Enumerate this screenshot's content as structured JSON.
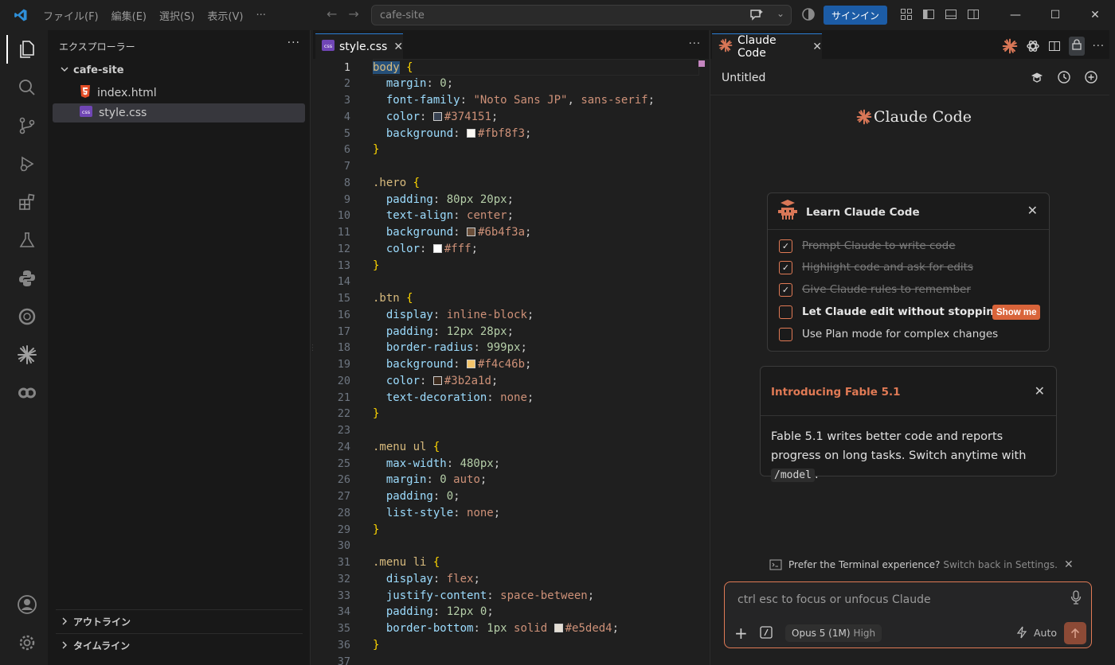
{
  "titlebar": {
    "menu": [
      "ファイル(F)",
      "編集(E)",
      "選択(S)",
      "表示(V)",
      "···"
    ],
    "search_text": "cafe-site",
    "signin_label": "サインイン"
  },
  "sidebar": {
    "header": "エクスプローラー",
    "more": "···",
    "folder": "cafe-site",
    "files": [
      {
        "name": "index.html",
        "type": "html"
      },
      {
        "name": "style.css",
        "type": "css"
      }
    ],
    "sections": [
      "アウトライン",
      "タイムライン"
    ]
  },
  "editor": {
    "tab_label": "style.css",
    "file_badge": "css",
    "more": "···",
    "line_numbers": [
      "1",
      "2",
      "3",
      "4",
      "5",
      "6",
      "7",
      "8",
      "9",
      "10",
      "11",
      "12",
      "13",
      "14",
      "15",
      "16",
      "17",
      "18",
      "19",
      "20",
      "21",
      "22",
      "23",
      "24",
      "25",
      "26",
      "27",
      "28",
      "29",
      "30",
      "31",
      "32",
      "33",
      "34",
      "35",
      "36",
      "37"
    ],
    "lines": [
      [
        [
          "sel",
          "body"
        ],
        [
          "",
          ""
        ],
        [
          "brace",
          " {"
        ]
      ],
      [
        [
          "",
          "  "
        ],
        [
          "prop",
          "margin"
        ],
        [
          "",
          ": "
        ],
        [
          "num",
          "0"
        ],
        [
          "",
          ";"
        ]
      ],
      [
        [
          "",
          "  "
        ],
        [
          "prop",
          "font-family"
        ],
        [
          "",
          ": "
        ],
        [
          "str",
          "\"Noto Sans JP\""
        ],
        [
          "",
          ", "
        ],
        [
          "val",
          "sans-serif"
        ],
        [
          "",
          ";"
        ]
      ],
      [
        [
          "",
          "  "
        ],
        [
          "prop",
          "color"
        ],
        [
          "",
          ": "
        ],
        [
          "sw",
          "#374151"
        ],
        [
          "val",
          "#374151"
        ],
        [
          "",
          ";"
        ]
      ],
      [
        [
          "",
          "  "
        ],
        [
          "prop",
          "background"
        ],
        [
          "",
          ": "
        ],
        [
          "sw",
          "#fbf8f3"
        ],
        [
          "val",
          "#fbf8f3"
        ],
        [
          "",
          ";"
        ]
      ],
      [
        [
          "brace",
          "}"
        ]
      ],
      [],
      [
        [
          "sel",
          ".hero"
        ],
        [
          "brace",
          " {"
        ]
      ],
      [
        [
          "",
          "  "
        ],
        [
          "prop",
          "padding"
        ],
        [
          "",
          ": "
        ],
        [
          "num",
          "80px 20px"
        ],
        [
          "",
          ";"
        ]
      ],
      [
        [
          "",
          "  "
        ],
        [
          "prop",
          "text-align"
        ],
        [
          "",
          ": "
        ],
        [
          "val",
          "center"
        ],
        [
          "",
          ";"
        ]
      ],
      [
        [
          "",
          "  "
        ],
        [
          "prop",
          "background"
        ],
        [
          "",
          ": "
        ],
        [
          "sw",
          "#6b4f3a"
        ],
        [
          "val",
          "#6b4f3a"
        ],
        [
          "",
          ";"
        ]
      ],
      [
        [
          "",
          "  "
        ],
        [
          "prop",
          "color"
        ],
        [
          "",
          ": "
        ],
        [
          "sw",
          "#fff"
        ],
        [
          "val",
          "#fff"
        ],
        [
          "",
          ";"
        ]
      ],
      [
        [
          "brace",
          "}"
        ]
      ],
      [],
      [
        [
          "sel",
          ".btn"
        ],
        [
          "brace",
          " {"
        ]
      ],
      [
        [
          "",
          "  "
        ],
        [
          "prop",
          "display"
        ],
        [
          "",
          ": "
        ],
        [
          "val",
          "inline-block"
        ],
        [
          "",
          ";"
        ]
      ],
      [
        [
          "",
          "  "
        ],
        [
          "prop",
          "padding"
        ],
        [
          "",
          ": "
        ],
        [
          "num",
          "12px 28px"
        ],
        [
          "",
          ";"
        ]
      ],
      [
        [
          "",
          "  "
        ],
        [
          "prop",
          "border-radius"
        ],
        [
          "",
          ": "
        ],
        [
          "num",
          "999px"
        ],
        [
          "",
          ";"
        ]
      ],
      [
        [
          "",
          "  "
        ],
        [
          "prop",
          "background"
        ],
        [
          "",
          ": "
        ],
        [
          "sw",
          "#f4c46b"
        ],
        [
          "val",
          "#f4c46b"
        ],
        [
          "",
          ";"
        ]
      ],
      [
        [
          "",
          "  "
        ],
        [
          "prop",
          "color"
        ],
        [
          "",
          ": "
        ],
        [
          "sw",
          "#3b2a1d"
        ],
        [
          "val",
          "#3b2a1d"
        ],
        [
          "",
          ";"
        ]
      ],
      [
        [
          "",
          "  "
        ],
        [
          "prop",
          "text-decoration"
        ],
        [
          "",
          ": "
        ],
        [
          "val",
          "none"
        ],
        [
          "",
          ";"
        ]
      ],
      [
        [
          "brace",
          "}"
        ]
      ],
      [],
      [
        [
          "sel",
          ".menu ul"
        ],
        [
          "brace",
          " {"
        ]
      ],
      [
        [
          "",
          "  "
        ],
        [
          "prop",
          "max-width"
        ],
        [
          "",
          ": "
        ],
        [
          "num",
          "480px"
        ],
        [
          "",
          ";"
        ]
      ],
      [
        [
          "",
          "  "
        ],
        [
          "prop",
          "margin"
        ],
        [
          "",
          ": "
        ],
        [
          "num",
          "0"
        ],
        [
          "",
          ""
        ],
        [
          "val",
          " auto"
        ],
        [
          "",
          ";"
        ]
      ],
      [
        [
          "",
          "  "
        ],
        [
          "prop",
          "padding"
        ],
        [
          "",
          ": "
        ],
        [
          "num",
          "0"
        ],
        [
          "",
          ";"
        ]
      ],
      [
        [
          "",
          "  "
        ],
        [
          "prop",
          "list-style"
        ],
        [
          "",
          ": "
        ],
        [
          "val",
          "none"
        ],
        [
          "",
          ";"
        ]
      ],
      [
        [
          "brace",
          "}"
        ]
      ],
      [],
      [
        [
          "sel",
          ".menu li"
        ],
        [
          "brace",
          " {"
        ]
      ],
      [
        [
          "",
          "  "
        ],
        [
          "prop",
          "display"
        ],
        [
          "",
          ": "
        ],
        [
          "val",
          "flex"
        ],
        [
          "",
          ";"
        ]
      ],
      [
        [
          "",
          "  "
        ],
        [
          "prop",
          "justify-content"
        ],
        [
          "",
          ": "
        ],
        [
          "val",
          "space-between"
        ],
        [
          "",
          ";"
        ]
      ],
      [
        [
          "",
          "  "
        ],
        [
          "prop",
          "padding"
        ],
        [
          "",
          ": "
        ],
        [
          "num",
          "12px 0"
        ],
        [
          "",
          ";"
        ]
      ],
      [
        [
          "",
          "  "
        ],
        [
          "prop",
          "border-bottom"
        ],
        [
          "",
          ": "
        ],
        [
          "num",
          "1px"
        ],
        [
          "val",
          " solid "
        ],
        [
          "sw",
          "#e5ded4"
        ],
        [
          "val",
          "#e5ded4"
        ],
        [
          "",
          ";"
        ]
      ],
      [
        [
          "brace",
          "}"
        ]
      ],
      []
    ]
  },
  "panel": {
    "tab_label": "Claude Code",
    "conversation_title": "Untitled",
    "brand": "Claude Code",
    "learn": {
      "title": "Learn Claude Code",
      "tasks": [
        {
          "label": "Prompt Claude to write code",
          "done": true
        },
        {
          "label": "Highlight code and ask for edits",
          "done": true
        },
        {
          "label": "Give Claude rules to remember",
          "done": true
        },
        {
          "label": "Let Claude edit without stopping",
          "done": false,
          "bold": true
        },
        {
          "label": "Use Plan mode for complex changes",
          "done": false
        }
      ],
      "show_me": "Show me"
    },
    "fable": {
      "title": "Introducing Fable 5.1",
      "body_before": "Fable 5.1 writes better code and reports progress on long tasks. Switch anytime with ",
      "command": "/model",
      "body_after": "."
    },
    "prefer": {
      "text": "Prefer the Terminal experience?",
      "link": "Switch back in Settings."
    },
    "input": {
      "placeholder": "ctrl esc to focus or unfocus Claude",
      "model": "Opus 5 (1M)",
      "effort": "High",
      "mode": "Auto"
    }
  },
  "colors": {
    "accent": "#e07a55",
    "brand_star": "#d97757",
    "signin": "#1c5ca6",
    "tab_border": "#2b7fd4"
  }
}
